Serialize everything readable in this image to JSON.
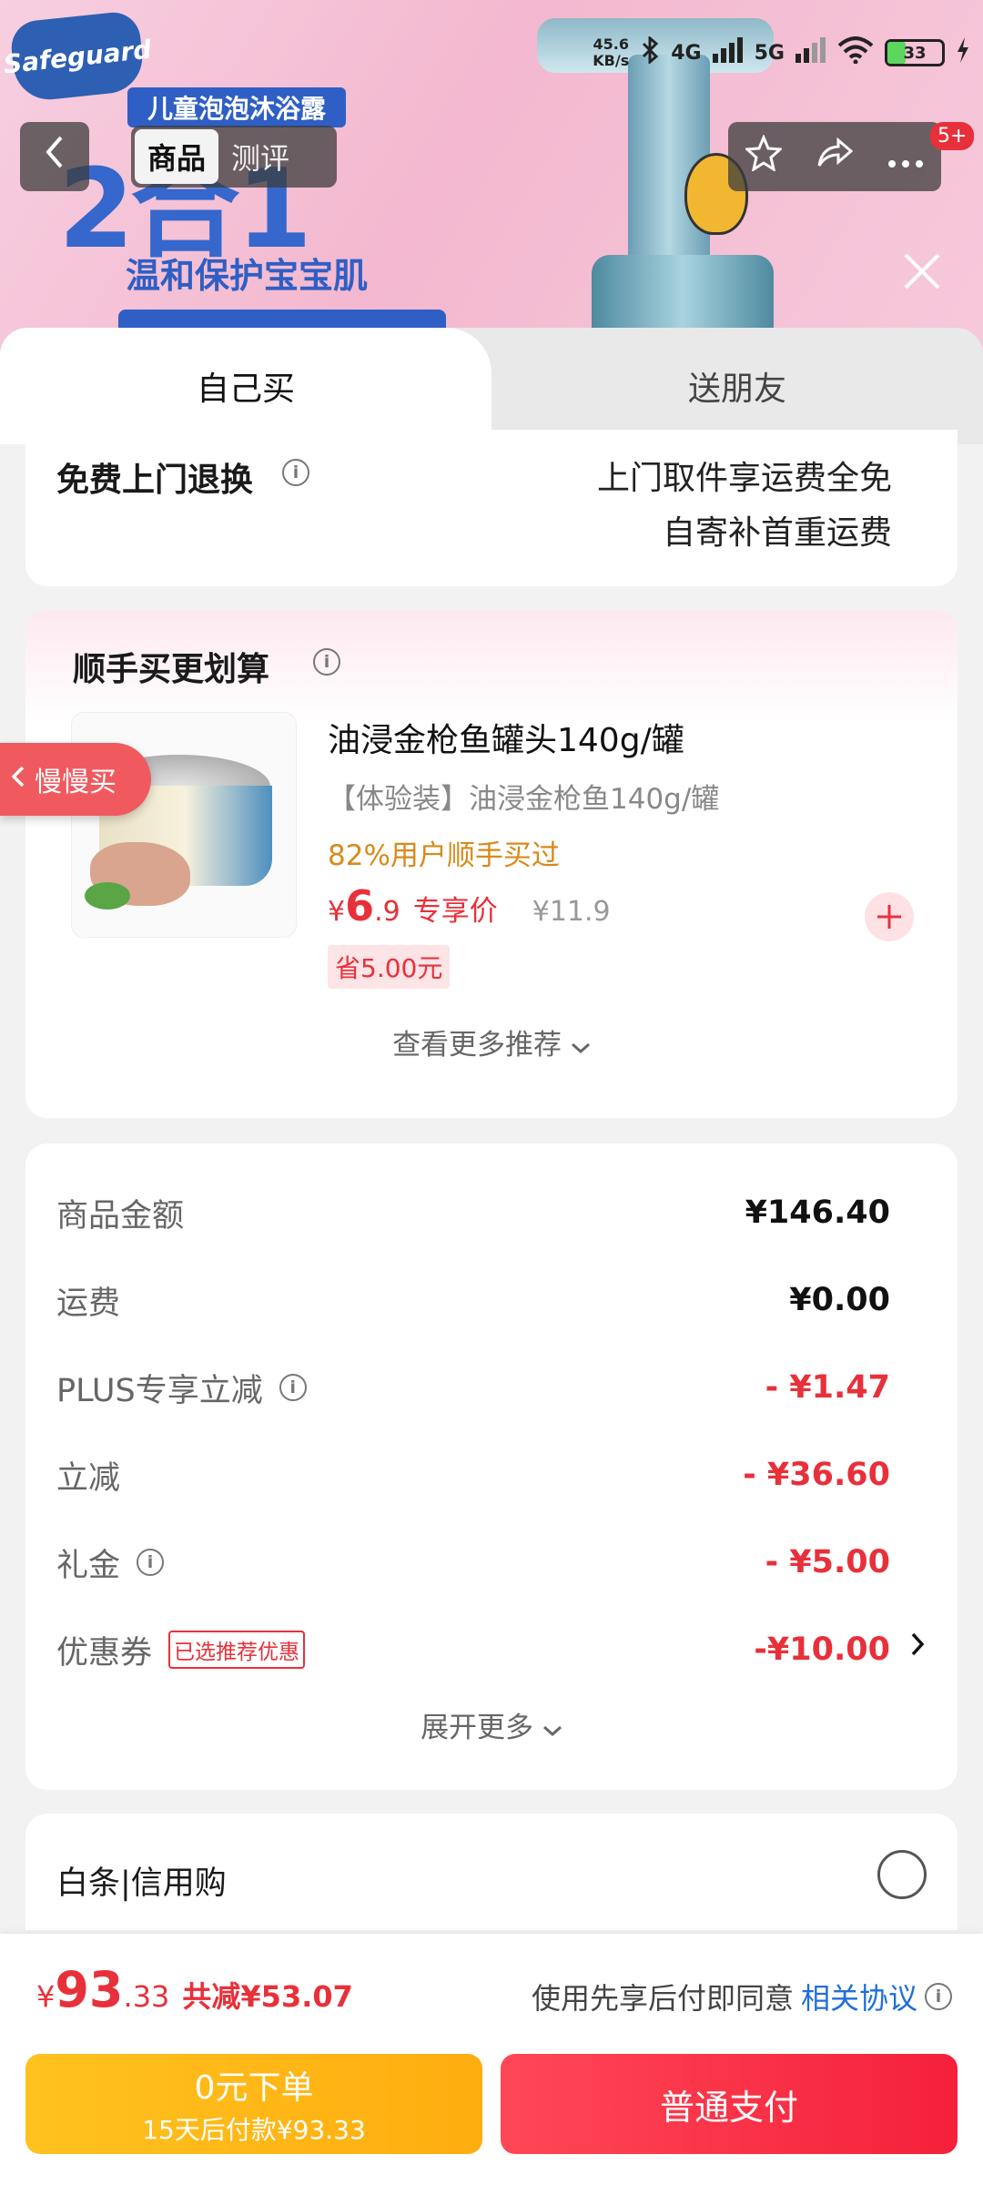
{
  "status_bar": {
    "net_speed_value": "45.6",
    "net_speed_unit": "KB/s",
    "network_4g": "4G",
    "network_5g": "5G",
    "battery": "33"
  },
  "banner": {
    "brand": "Safeguard",
    "kids_title": "儿童泡泡沐浴露",
    "big_text": "2合1",
    "slogan": "温和保护宝宝肌"
  },
  "nav": {
    "tabs": [
      "商品",
      "测评"
    ],
    "badge": "5+"
  },
  "sheet_tabs": {
    "self": "自己买",
    "friend": "送朋友"
  },
  "return_service": {
    "title": "免费上门退换",
    "line1": "上门取件享运费全免",
    "line2": "自寄补首重运费"
  },
  "addon": {
    "title": "顺手买更划算",
    "product": {
      "name": "油浸金枪鱼罐头140g/罐",
      "variant": "【体验装】油浸金枪鱼140g/罐",
      "social_proof": "82%用户顺手买过",
      "price_symbol": "¥",
      "price_int": "6",
      "price_dec": ".9",
      "price_label": "专享价",
      "original_price": "¥11.9",
      "save_tag": "省5.00元"
    },
    "more": "查看更多推荐"
  },
  "float_tag": "慢慢买",
  "price_breakdown": {
    "rows": [
      {
        "label": "商品金额",
        "value": "¥146.40"
      },
      {
        "label": "运费",
        "value": "¥0.00"
      },
      {
        "label": "PLUS专享立减",
        "value": "- ¥1.47"
      },
      {
        "label": "立减",
        "value": "- ¥36.60"
      },
      {
        "label": "礼金",
        "value": "- ¥5.00"
      },
      {
        "label": "优惠券",
        "tag": "已选推荐优惠",
        "value": "-¥10.00"
      }
    ],
    "expand": "展开更多"
  },
  "baitiao": {
    "label": "白条|信用购"
  },
  "bottom": {
    "total_symbol": "¥",
    "total_int": "93",
    "total_dec": ".33",
    "total_save": "共减¥53.07",
    "agreement_text": "使用先享后付即同意",
    "agreement_link": "相关协议",
    "later_main": "0元下单",
    "later_sub": "15天后付款¥93.33",
    "pay": "普通支付"
  },
  "colors": {
    "accent_red": "#e8303a",
    "pay_yellow": "#ffb515",
    "link_blue": "#1f6fd8"
  }
}
